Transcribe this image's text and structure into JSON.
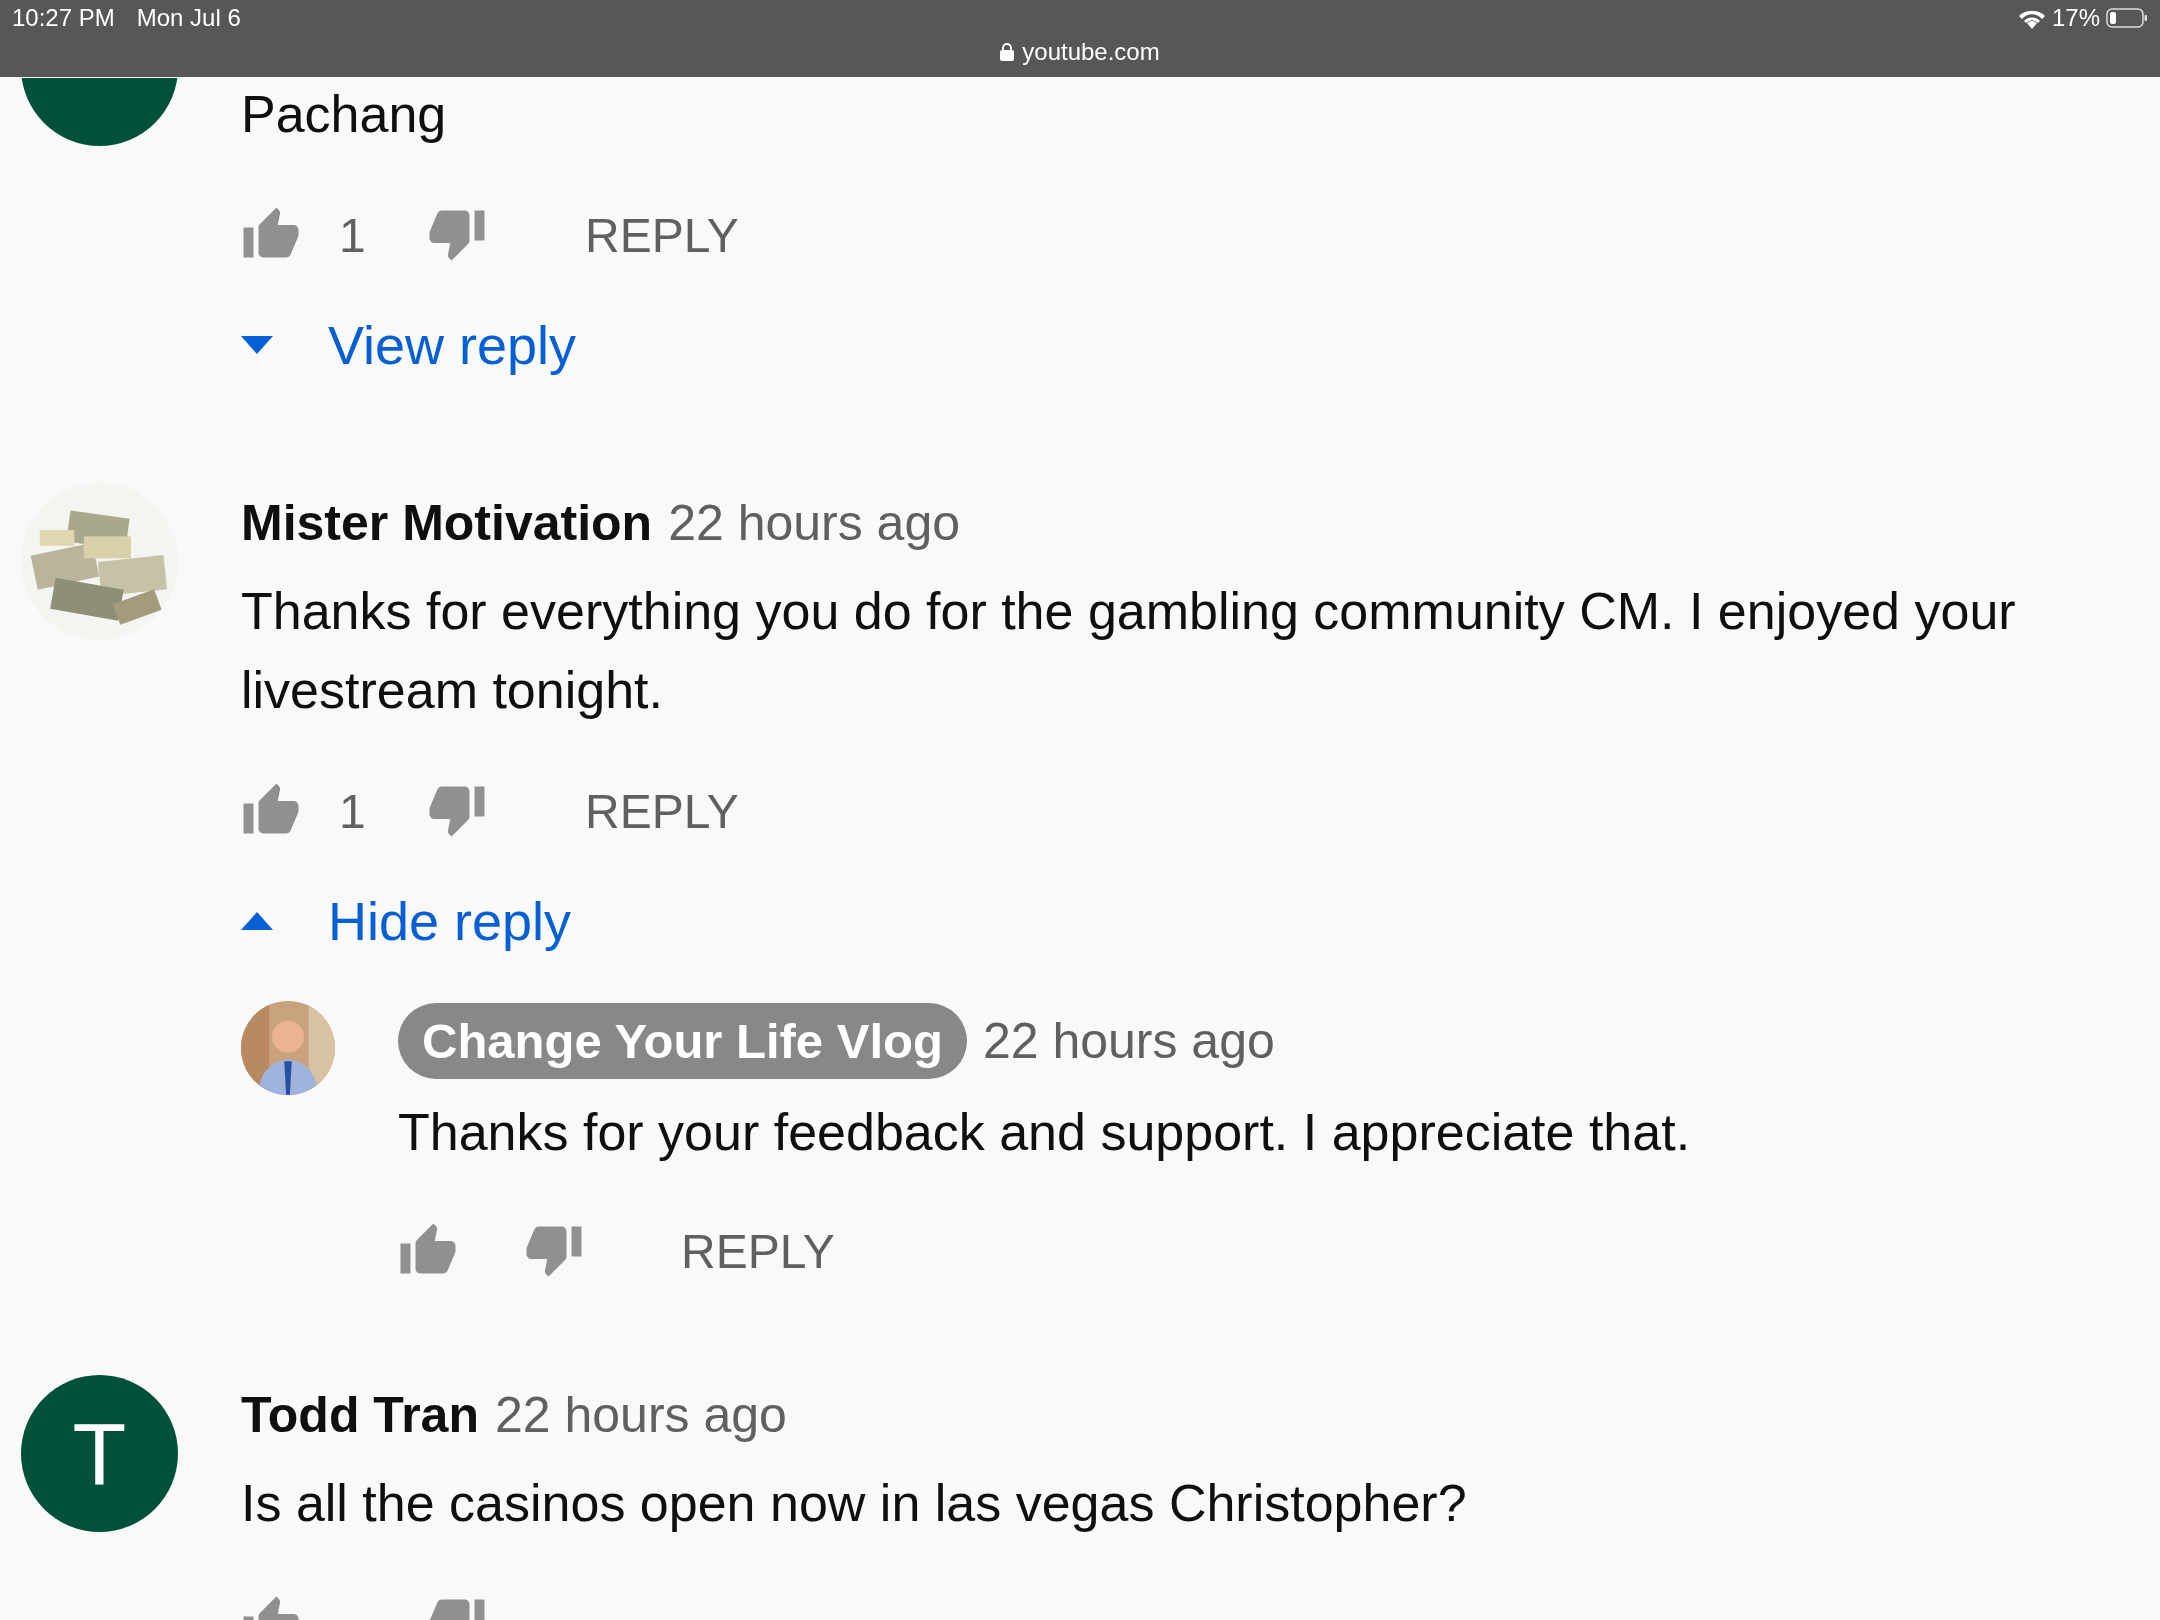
{
  "status_bar": {
    "time": "10:27 PM",
    "date": "Mon Jul 6",
    "url": "youtube.com",
    "battery": "17%"
  },
  "comments": [
    {
      "avatar": {
        "kind": "letter"
      },
      "text": "Pachang",
      "likes": "1",
      "reply_label": "REPLY",
      "replies_toggle": {
        "label": "View reply",
        "expanded": false
      }
    },
    {
      "author": "Mister Motivation",
      "owner": false,
      "time": "22 hours ago",
      "text": "Thanks for everything you do for the gambling community CM. I enjoyed your livestream tonight.",
      "likes": "1",
      "reply_label": "REPLY",
      "replies_toggle": {
        "label": "Hide reply",
        "expanded": true
      },
      "replies": [
        {
          "avatar": {
            "kind": "person"
          },
          "author": "Change Your Life Vlog",
          "owner": true,
          "time": "22 hours ago",
          "text": "Thanks for your feedback and support. I appreciate that.",
          "reply_label": "REPLY"
        }
      ]
    },
    {
      "avatar": {
        "kind": "letter",
        "letter": "T"
      },
      "author": "Todd Tran",
      "owner": false,
      "time": "22 hours ago",
      "text": "Is all the casinos open now  in las vegas Christopher?"
    }
  ]
}
